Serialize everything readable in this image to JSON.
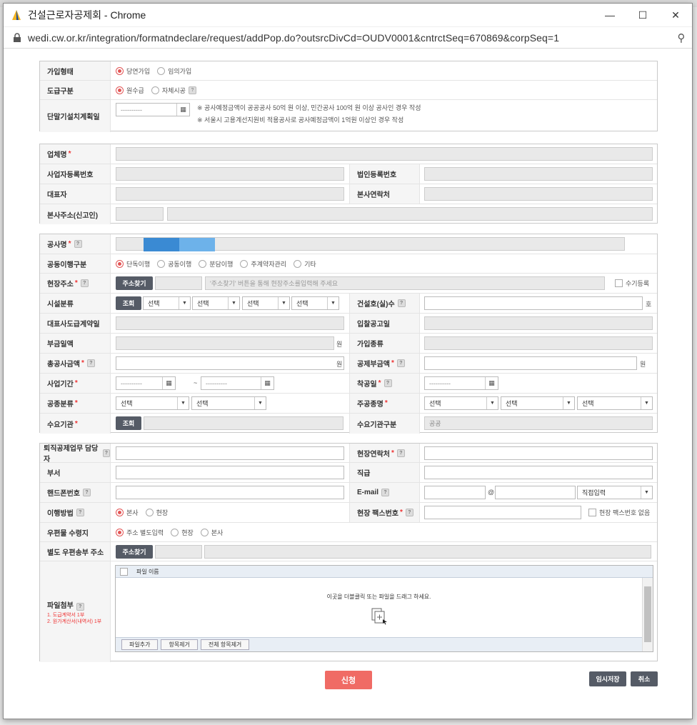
{
  "window": {
    "title": "건설근로자공제회 - Chrome",
    "url": "wedi.cw.or.kr/integration/formatndeclare/request/addPop.do?outsrcDivCd=OUDV0001&cntrctSeq=670869&corpSeq=1"
  },
  "section1": {
    "join_type_label": "가입형태",
    "join_options": [
      "당연가입",
      "임의가입"
    ],
    "contract_type_label": "도급구분",
    "contract_options": [
      "원수급",
      "자체시공"
    ],
    "terminal_label": "단말기설치계획일",
    "date_placeholder": "----------",
    "note1": "※ 공사예정금액이 공공공사 50억 원 이상, 민간공사 100억 원 이상 공사인 경우 작성",
    "note2": "※ 서울시 고용계선지원비 적용공사로 공사예정금액이 1억원 이상인 경우 작성"
  },
  "section2": {
    "company_label": "업체명",
    "bizno_label": "사업자등록번호",
    "corpno_label": "법인등록번호",
    "ceo_label": "대표자",
    "hq_contact_label": "본사연락처",
    "hq_address_label": "본사주소(신고인)"
  },
  "section3": {
    "project_label": "공사명",
    "joint_label": "공동이행구분",
    "joint_options": [
      "단독이행",
      "공동이행",
      "분담이행",
      "주계약자관리",
      "기타"
    ],
    "site_address_label": "현장주소",
    "address_search_btn": "주소찾기",
    "address_hint": "'주소찾기' 버튼을 통해 현장주소를입력해 주세요",
    "manual_label": "수기등록",
    "facility_label": "시설분류",
    "lookup_btn": "조회",
    "select_placeholder": "선택",
    "building_label": "건설호(실)수",
    "unit_ho": "호",
    "prime_date_label": "대표사도급계약일",
    "bid_date_label": "입찰공고일",
    "vat_label": "부금일액",
    "unit_won": "원",
    "join_kind_label": "가입종류",
    "total_cost_label": "총공사금액",
    "deduct_label": "공제부금액",
    "period_label": "사업기간",
    "tilde": "~",
    "start_date_label": "착공일",
    "work_type_label": "공종분류",
    "main_work_label": "주공종명",
    "client_label": "수요기관",
    "client_type_label": "수요기관구분",
    "client_type_value": "공공"
  },
  "section4": {
    "manager_label": "퇴직공제업무 담당자",
    "site_contact_label": "현장연락처",
    "dept_label": "부서",
    "position_label": "직급",
    "mobile_label": "핸드폰번호",
    "email_label": "E-mail",
    "at_sign": "@",
    "email_select": "직접입력",
    "method_label": "이행방법",
    "method_options": [
      "본사",
      "현장"
    ],
    "fax_label": "현장 팩스번호",
    "no_fax_label": "현장 팩스번호 없음",
    "mail_label": "우편물 수령지",
    "mail_options": [
      "주소 별도입력",
      "현장",
      "본사"
    ],
    "mail_addr_label": "별도 우편송부 주소",
    "attach_label": "파일첨부",
    "attach_note1": "1. 도급계약서 1부",
    "attach_note2": "2. 원가계산서(내역서) 1부",
    "file_col": "파일 이름",
    "drop_text": "이곳을 더블클릭 또는 파일을 드래그 하세요.",
    "add_file_btn": "파일추가",
    "remove_btn": "항목제거",
    "remove_all_btn": "전체 항목제거"
  },
  "actions": {
    "submit": "신청",
    "temp_save": "임시저장",
    "cancel": "취소"
  },
  "colors": {
    "accent_red": "#f06b65",
    "dark_button": "#555b66",
    "radio_on": "#e25555"
  }
}
